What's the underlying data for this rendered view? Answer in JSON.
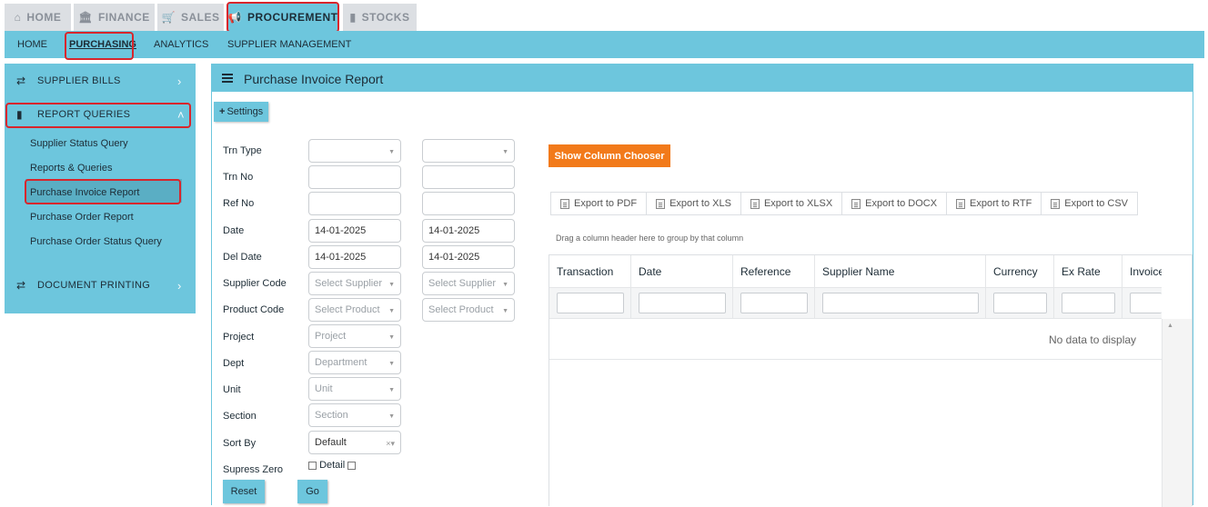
{
  "top_tabs": [
    {
      "label": "HOME",
      "icon": "home-icon"
    },
    {
      "label": "FINANCE",
      "icon": "bank-icon"
    },
    {
      "label": "SALES",
      "icon": "cart-icon"
    },
    {
      "label": "PROCUREMENT",
      "icon": "megaphone-icon"
    },
    {
      "label": "STOCKS",
      "icon": "bar-chart-icon"
    }
  ],
  "sub_nav": [
    "HOME",
    "PURCHASING",
    "ANALYTICS",
    "SUPPLIER MANAGEMENT"
  ],
  "sidebar": {
    "sections": [
      {
        "label": "SUPPLIER BILLS",
        "icon": "exchange-icon"
      },
      {
        "label": "REPORT QUERIES",
        "icon": "bar-chart-icon"
      },
      {
        "label": "DOCUMENT PRINTING",
        "icon": "exchange-icon"
      }
    ],
    "links": [
      "Supplier Status Query",
      "Reports & Queries",
      "Purchase Invoice Report",
      "Purchase Order Report",
      "Purchase Order Status Query"
    ]
  },
  "panel": {
    "title": "Purchase Invoice Report",
    "settings_label": "Settings"
  },
  "form": {
    "labels": [
      "Trn Type",
      "Trn No",
      "Ref No",
      "Date",
      "Del Date",
      "Supplier Code",
      "Product Code",
      "Project",
      "Dept",
      "Unit",
      "Section",
      "Sort By",
      "Supress Zero"
    ],
    "date_from": "14-01-2025",
    "date_to": "14-01-2025",
    "del_date_from": "14-01-2025",
    "del_date_to": "14-01-2025",
    "supplier_placeholder": "Select Supplier",
    "product_placeholder": "Select Product",
    "project_placeholder": "Project",
    "dept_placeholder": "Department",
    "unit_placeholder": "Unit",
    "section_placeholder": "Section",
    "sort_by_value": "Default",
    "detail_label": "Detail",
    "reset_label": "Reset",
    "go_label": "Go"
  },
  "grid": {
    "chooser_label": "Show Column Chooser",
    "exports": [
      "Export to PDF",
      "Export to XLS",
      "Export to XLSX",
      "Export to DOCX",
      "Export to RTF",
      "Export to CSV"
    ],
    "group_hint": "Drag a column header here to group by that column",
    "columns": [
      "Transaction",
      "Date",
      "Reference",
      "Supplier Name",
      "Currency",
      "Ex Rate",
      "Invoice"
    ],
    "empty_text": "No data to display"
  }
}
